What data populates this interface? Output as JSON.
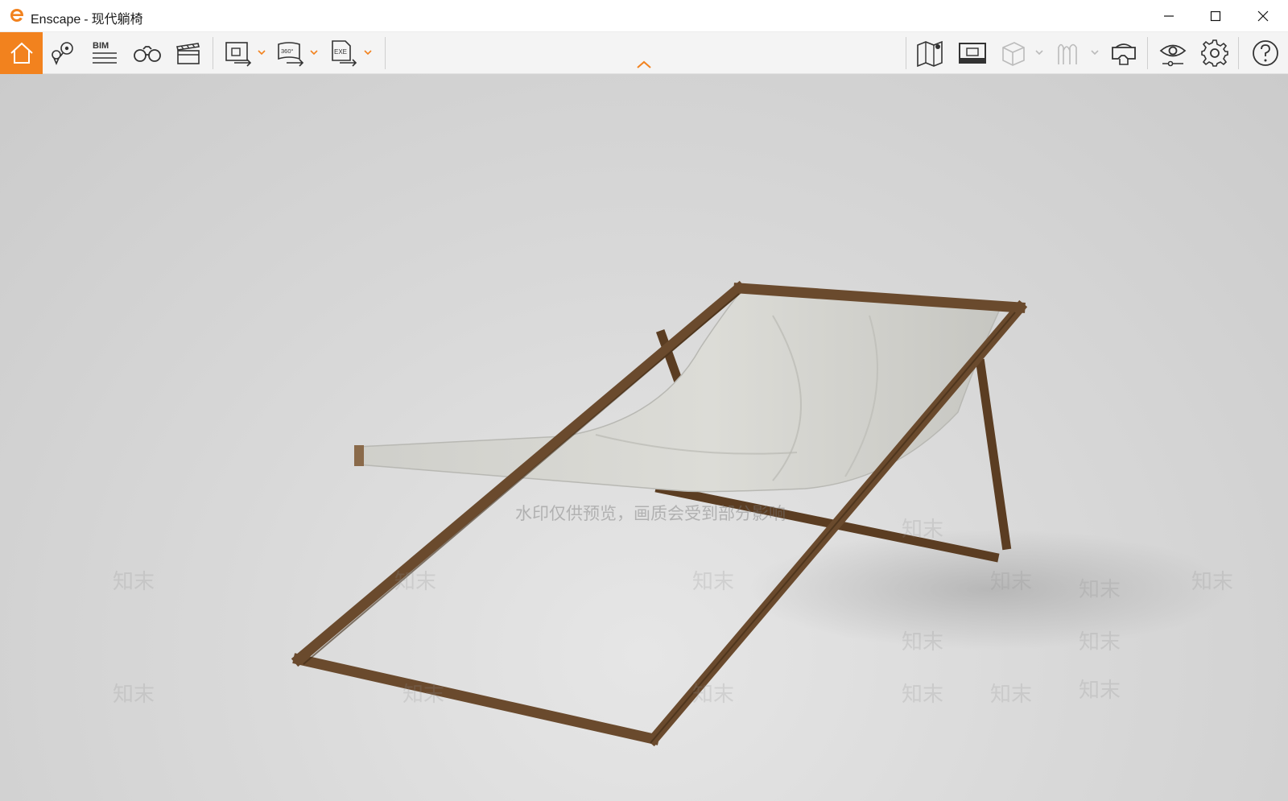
{
  "window": {
    "app_name": "Enscape",
    "separator": "-",
    "document_title": "现代躺椅",
    "brand_color": "#f2821e"
  },
  "toolbar": {
    "bim_label": "BIM",
    "panorama_label": "360°",
    "exe_label": "EXE",
    "icons": [
      "home-icon",
      "location-pin-icon",
      "bim-icon",
      "binoculars-icon",
      "clapperboard-icon",
      "screenshot-export-icon",
      "panorama-export-icon",
      "exe-export-icon",
      "map-icon",
      "capture-icon",
      "cube-icon",
      "asset-library-icon",
      "vr-headset-icon",
      "visual-settings-icon",
      "settings-icon",
      "help-icon"
    ]
  },
  "viewport": {
    "watermark_banner": "水印仅供预览，画质会受到部分影响",
    "watermark_text": "知末",
    "fabric_color": "#d9d9d3",
    "wood_color": "#6a4a2d"
  }
}
